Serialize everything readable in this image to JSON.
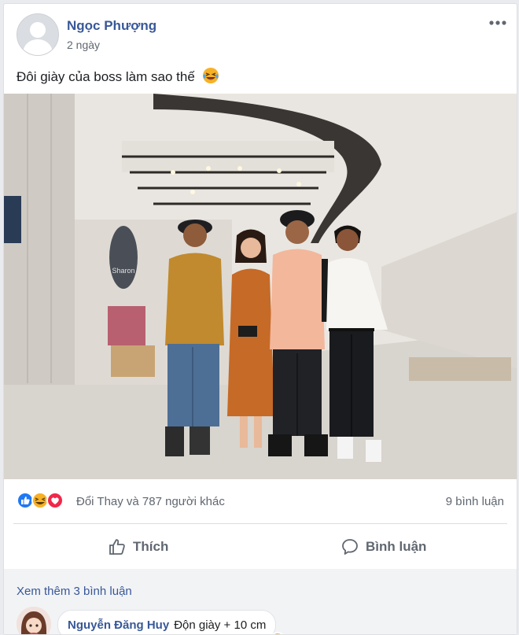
{
  "post": {
    "author": "Ngọc Phượng",
    "time": "2 ngày",
    "text": "Đôi giày của boss làm sao thế",
    "text_emoji": "laughing-tears-emoji",
    "options_icon": "more-horizontal-icon"
  },
  "photo": {
    "description_icon": "group-photo",
    "sign_text": "Sharon"
  },
  "reactions": {
    "icons": [
      "like-reaction",
      "haha-reaction",
      "love-reaction"
    ],
    "names_text": "Đổi Thay và 787 người khác",
    "comments_count": "9 bình luận"
  },
  "actions": {
    "like_label": "Thích",
    "comment_label": "Bình luận"
  },
  "comments": {
    "see_more": "Xem thêm 3 bình luận",
    "items": [
      {
        "name": "Nguyễn Đăng Huy",
        "text": "Độn giày + 10 cm",
        "reaction_icon": "haha-reaction"
      }
    ]
  },
  "colors": {
    "link": "#385898",
    "secondary_text": "#606770",
    "like_blue": "#2078f4",
    "love_red": "#f0284a",
    "haha_yellow": "#f7b125"
  }
}
